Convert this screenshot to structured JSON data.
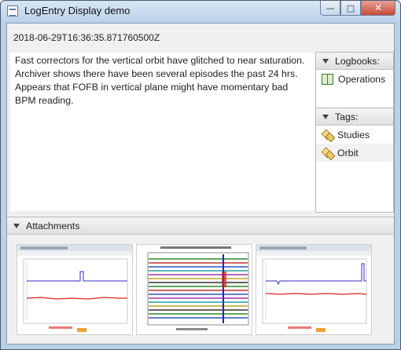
{
  "window": {
    "title": "LogEntry Display demo",
    "buttons": {
      "minimize": "—",
      "maximize": "□",
      "close": "✕"
    }
  },
  "entry": {
    "timestamp": "2018-06-29T16:36:35.871760500Z",
    "description": "Fast correctors for the vertical orbit have glitched to near saturation. Archiver shows there have been several episodes the past 24 hrs. Appears that FOFB in vertical plane might have momentary bad BPM reading."
  },
  "logbooks": {
    "header": "Logbooks:",
    "items": [
      {
        "label": "Operations",
        "icon": "logbook-icon"
      }
    ]
  },
  "tags": {
    "header": "Tags:",
    "items": [
      {
        "label": "Studies",
        "icon": "tag-icon"
      },
      {
        "label": "Orbit",
        "icon": "tag-icon"
      }
    ]
  },
  "attachments": {
    "header": "Attachments",
    "items": [
      {
        "kind": "screenshot-plot"
      },
      {
        "kind": "orbit-plot"
      },
      {
        "kind": "screenshot-plot"
      }
    ]
  },
  "colors": {
    "title_bar": "#bcd1e8",
    "close_button": "#c9483a",
    "trace_blue": "#3030c0",
    "trace_red": "#e02020"
  }
}
